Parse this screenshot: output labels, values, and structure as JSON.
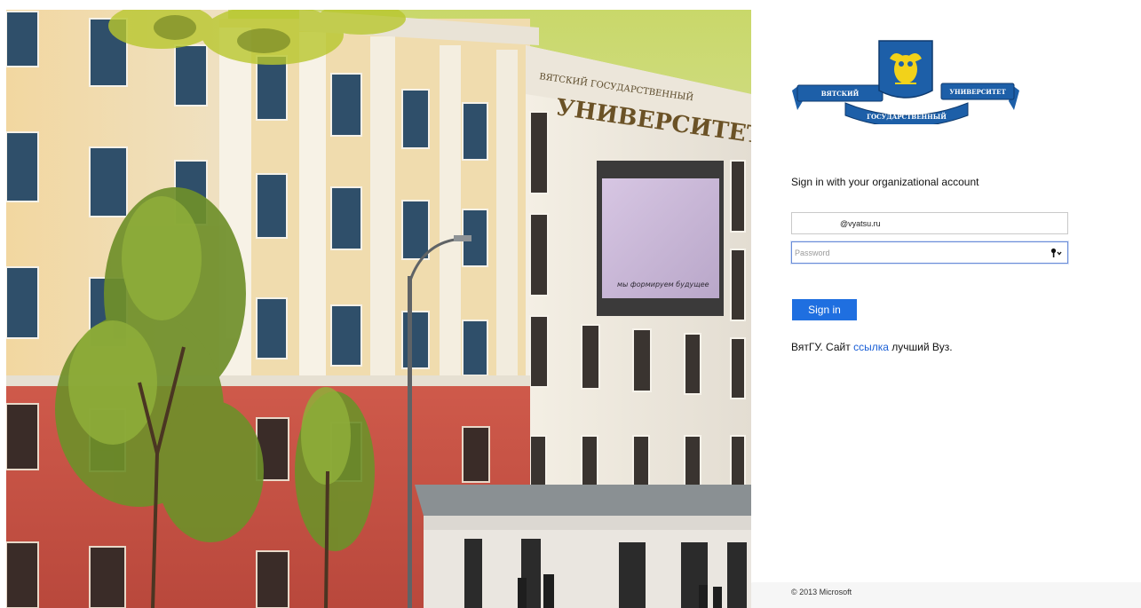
{
  "illustration": {
    "sign_top": "ВЯТСКИЙ ГОСУДАРСТВЕННЫЙ",
    "sign_main": "УНИВЕРСИТЕТ",
    "screen_caption": "мы формируем будущее"
  },
  "logo": {
    "left_ribbon": "ВЯТСКИЙ",
    "right_ribbon": "УНИВЕРСИТЕТ",
    "bottom_ribbon": "ГОСУДАРСТВЕННЫЙ"
  },
  "signin": {
    "heading": "Sign in with your organizational account",
    "email_value": "@vyatsu.ru",
    "password_placeholder": "Password",
    "button_label": "Sign in"
  },
  "note": {
    "prefix": "ВятГУ. Сайт ",
    "link_text": "ссылка",
    "suffix": " лучший Вуз."
  },
  "footer": {
    "copyright": "© 2013 Microsoft"
  },
  "colors": {
    "accent": "#1f6fe0",
    "link": "#1a5fd6",
    "logo_blue": "#1d5fa8",
    "logo_gold": "#f2d21a"
  }
}
